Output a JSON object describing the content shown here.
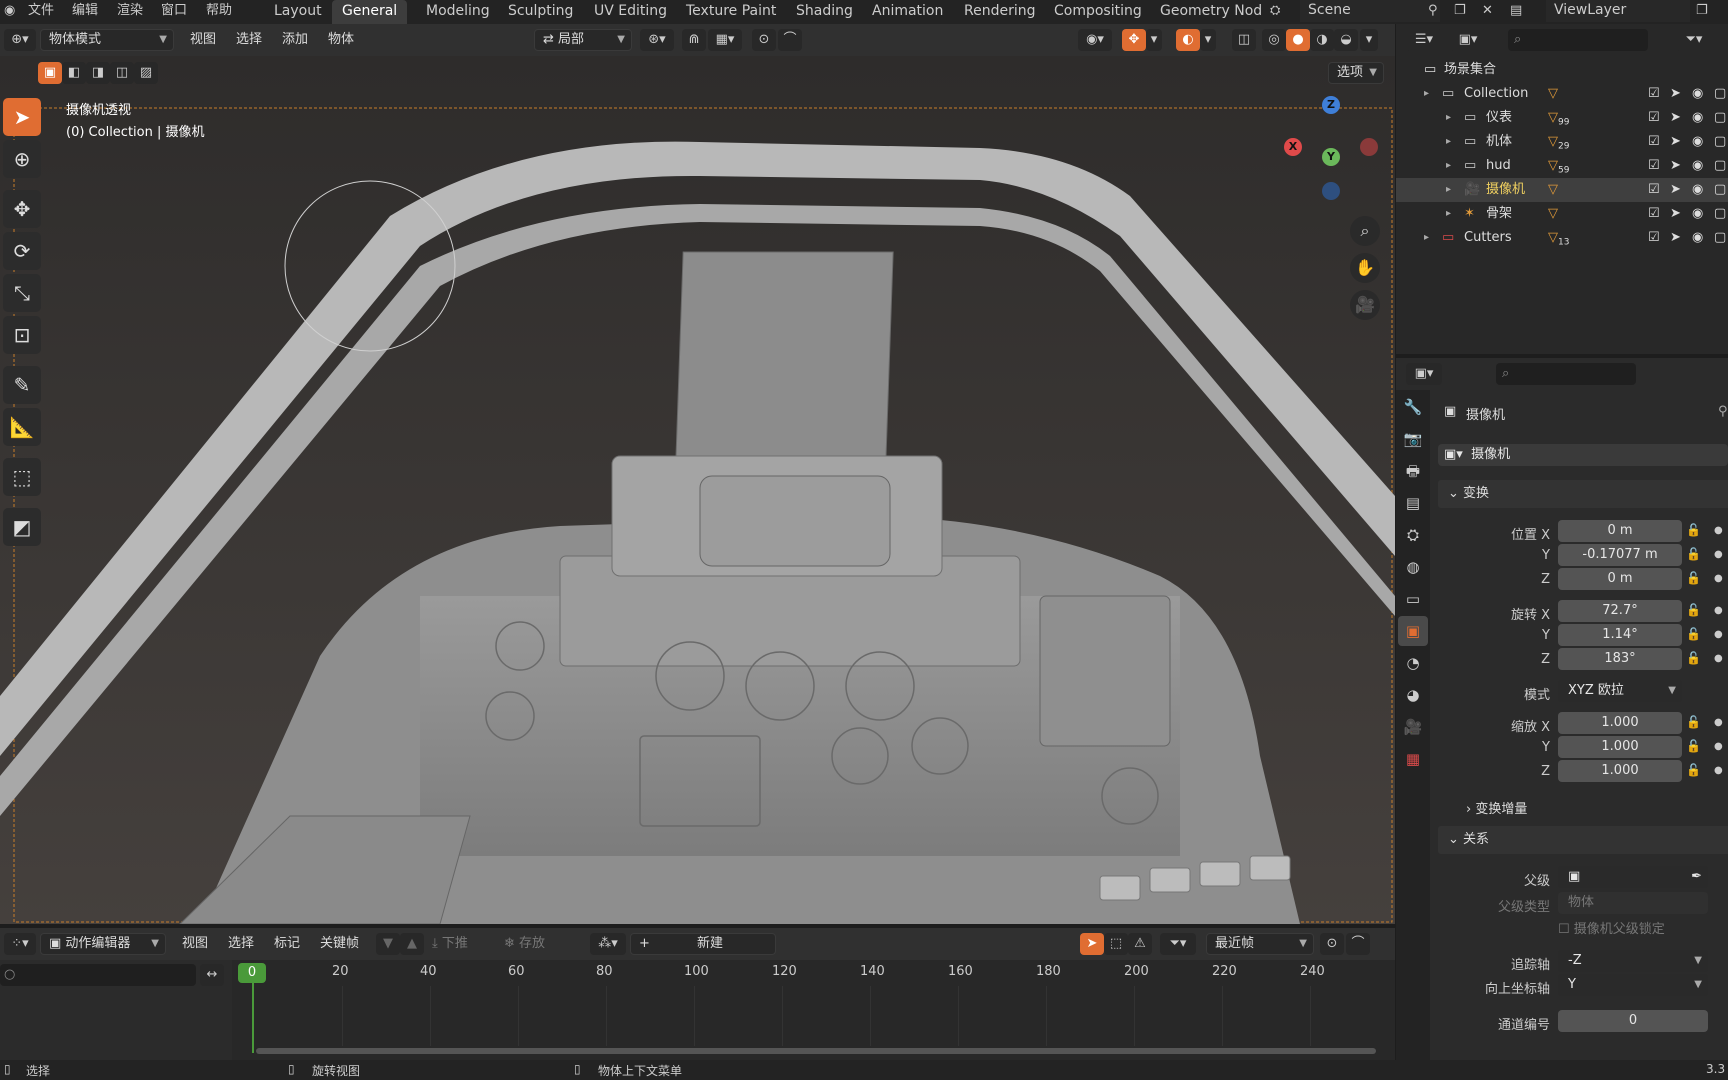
{
  "topbar": {
    "menus": [
      "文件",
      "编辑",
      "渲染",
      "窗口",
      "帮助"
    ],
    "workspaces": [
      "Layout",
      "General",
      "Modeling",
      "Sculpting",
      "UV Editing",
      "Texture Paint",
      "Shading",
      "Animation",
      "Rendering",
      "Compositing",
      "Geometry Nod"
    ],
    "active_workspace": "General",
    "scene": "Scene",
    "view_layer": "ViewLayer"
  },
  "viewport_header": {
    "mode": "物体模式",
    "menus": [
      "视图",
      "选择",
      "添加",
      "物体"
    ],
    "transform_orientation": "局部",
    "options": "选项"
  },
  "viewport": {
    "view_name": "摄像机透视",
    "context": "(0) Collection | 摄像机",
    "gizmo": {
      "x": "X",
      "y": "Y",
      "z": "Z"
    }
  },
  "outliner": {
    "root": "场景集合",
    "rows": [
      {
        "name": "Collection",
        "badge": "",
        "depth": 1
      },
      {
        "name": "仪表",
        "badge": "99",
        "depth": 2
      },
      {
        "name": "机体",
        "badge": "29",
        "depth": 2
      },
      {
        "name": "hud",
        "badge": "59",
        "depth": 2
      },
      {
        "name": "摄像机",
        "badge": "",
        "depth": 2
      },
      {
        "name": "骨架",
        "badge": "",
        "depth": 2
      },
      {
        "name": "Cutters",
        "badge": "13",
        "depth": 1
      }
    ]
  },
  "properties": {
    "object_name": "摄像机",
    "data_name": "摄像机",
    "transform_title": "变换",
    "location_label": "位置",
    "location": {
      "x": "0 m",
      "y": "-0.17077 m",
      "z": "0 m"
    },
    "rotation_label": "旋转",
    "rotation": {
      "x": "72.7°",
      "y": "1.14°",
      "z": "183°"
    },
    "mode_label": "模式",
    "mode": "XYZ 欧拉",
    "scale_label": "缩放",
    "scale": {
      "x": "1.000",
      "y": "1.000",
      "z": "1.000"
    },
    "delta_title": "变换增量",
    "relations_title": "关系",
    "parent_label": "父级",
    "parent_type_label": "父级类型",
    "parent_type": "物体",
    "camera_parent_lock": "摄像机父级锁定",
    "track_axis_label": "追踪轴",
    "track_axis": "-Z",
    "up_axis_label": "向上坐标轴",
    "up_axis": "Y",
    "pass_index_label": "通道编号",
    "pass_index": "0"
  },
  "dopesheet": {
    "editor": "动作编辑器",
    "menus": [
      "视图",
      "选择",
      "标记",
      "关键帧"
    ],
    "push_down": "下推",
    "stash": "存放",
    "new": "新建",
    "snap": "最近帧",
    "current_frame": "0",
    "frames": [
      "20",
      "40",
      "60",
      "80",
      "100",
      "120",
      "140",
      "160",
      "180",
      "200",
      "220",
      "240"
    ]
  },
  "statusbar": {
    "select": "选择",
    "rotate": "旋转视图",
    "context_menu": "物体上下文菜单",
    "version": "3.3"
  },
  "colors": {
    "accent": "#e06d32",
    "active_tab": "#3d3d3d",
    "x_axis": "#e04a4a",
    "y_axis": "#6bb85b",
    "z_axis": "#3f7fd8"
  }
}
